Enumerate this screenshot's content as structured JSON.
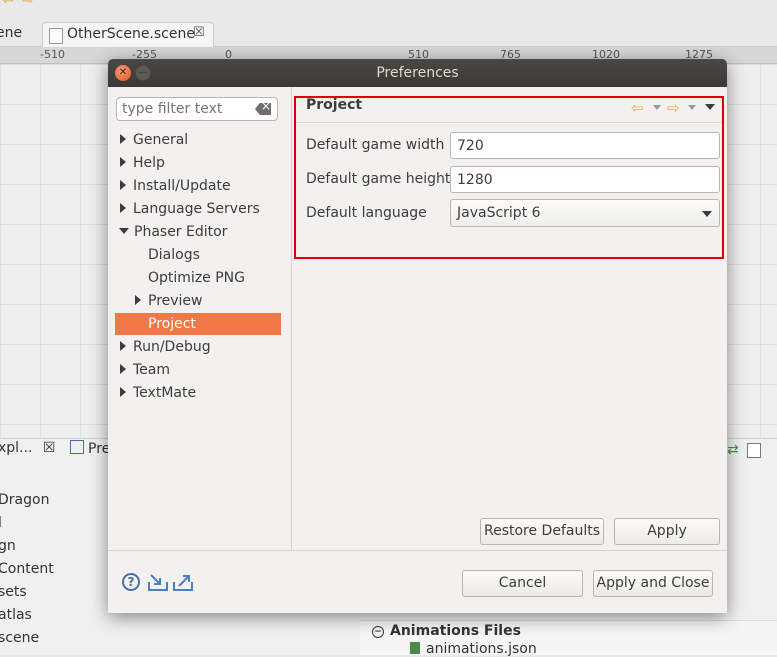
{
  "background": {
    "tab_partial": "ene",
    "active_tab": "OtherScene.scene",
    "ruler": [
      "-510",
      "-255",
      "0",
      "510",
      "765",
      "1020",
      "1275"
    ],
    "explorer_tab": "xpl...",
    "second_tab": "Pre",
    "explorer_items": [
      "Dragon",
      "l",
      "gn",
      "Content",
      "sets",
      "atlas",
      "scene"
    ],
    "animations_header": "Animations Files",
    "animations_file": "animations.json"
  },
  "dialog": {
    "title": "Preferences",
    "filter_placeholder": "type filter text",
    "tree": [
      {
        "label": "General",
        "level": 0,
        "arrow": "closed"
      },
      {
        "label": "Help",
        "level": 0,
        "arrow": "closed"
      },
      {
        "label": "Install/Update",
        "level": 0,
        "arrow": "closed"
      },
      {
        "label": "Language Servers",
        "level": 0,
        "arrow": "closed"
      },
      {
        "label": "Phaser Editor",
        "level": 0,
        "arrow": "open"
      },
      {
        "label": "Dialogs",
        "level": 1,
        "arrow": "none"
      },
      {
        "label": "Optimize PNG",
        "level": 1,
        "arrow": "none"
      },
      {
        "label": "Preview",
        "level": 1,
        "arrow": "closed"
      },
      {
        "label": "Project",
        "level": 1,
        "arrow": "none",
        "selected": true
      },
      {
        "label": "Run/Debug",
        "level": 0,
        "arrow": "closed"
      },
      {
        "label": "Team",
        "level": 0,
        "arrow": "closed"
      },
      {
        "label": "TextMate",
        "level": 0,
        "arrow": "closed"
      }
    ],
    "page": {
      "title": "Project",
      "fields": [
        {
          "label": "Default game width",
          "value": "720"
        },
        {
          "label": "Default game height",
          "value": "1280"
        }
      ],
      "language_label": "Default language",
      "language_value": "JavaScript 6"
    },
    "buttons": {
      "restore_defaults": "Restore Defaults",
      "apply": "Apply",
      "cancel": "Cancel",
      "apply_and_close": "Apply and Close"
    },
    "highlight_color": "#e00000",
    "selection_color": "#f07746"
  }
}
